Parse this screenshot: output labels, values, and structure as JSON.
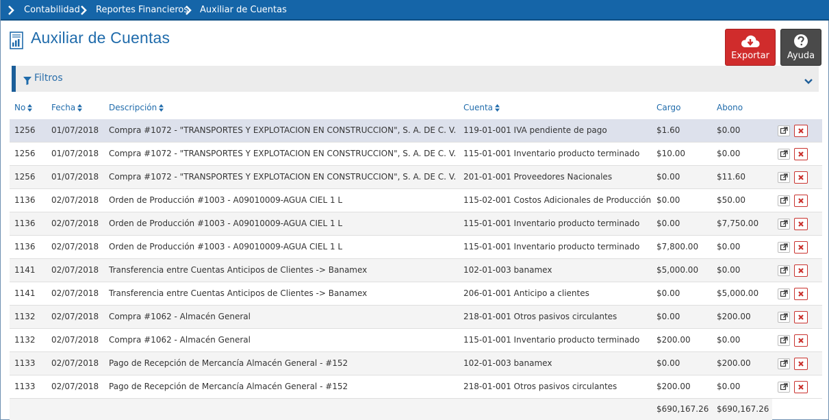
{
  "breadcrumb": [
    "Contabilidad",
    "Reportes Financieros",
    "Auxiliar de Cuentas"
  ],
  "page": {
    "title": "Auxiliar de Cuentas"
  },
  "toolbar": {
    "export_label": "Exportar",
    "help_label": "Ayuda"
  },
  "filters": {
    "label": "Filtros"
  },
  "colors": {
    "topbar": "#1565a8",
    "accent": "#1f6bab",
    "export": "#d02c2c",
    "help": "#4a4a4a",
    "selected_row": "#dde1ec"
  },
  "icons": {
    "title": "report-icon",
    "export": "cloud-download-icon",
    "help": "question-circle-icon",
    "filter": "filter-icon",
    "edit": "external-link-icon",
    "delete": "close-icon"
  },
  "table": {
    "columns": {
      "no": "No",
      "fecha": "Fecha",
      "descripcion": "Descripción",
      "cuenta": "Cuenta",
      "cargo": "Cargo",
      "abono": "Abono"
    },
    "rows": [
      {
        "no": "1256",
        "fecha": "01/07/2018",
        "descripcion": "Compra #1072 - \"TRANSPORTES Y EXPLOTACION EN CONSTRUCCION\", S. A. DE C. V.",
        "cuenta": "119-01-001 IVA pendiente de pago",
        "cargo": "$1.60",
        "abono": "$0.00",
        "selected": true
      },
      {
        "no": "1256",
        "fecha": "01/07/2018",
        "descripcion": "Compra #1072 - \"TRANSPORTES Y EXPLOTACION EN CONSTRUCCION\", S. A. DE C. V.",
        "cuenta": "115-01-001 Inventario producto terminado",
        "cargo": "$10.00",
        "abono": "$0.00"
      },
      {
        "no": "1256",
        "fecha": "01/07/2018",
        "descripcion": "Compra #1072 - \"TRANSPORTES Y EXPLOTACION EN CONSTRUCCION\", S. A. DE C. V.",
        "cuenta": "201-01-001 Proveedores Nacionales",
        "cargo": "$0.00",
        "abono": "$11.60"
      },
      {
        "no": "1136",
        "fecha": "02/07/2018",
        "descripcion": "Orden de Producción #1003 - A09010009-AGUA CIEL 1 L",
        "cuenta": "115-02-001 Costos Adicionales de Producción",
        "cargo": "$0.00",
        "abono": "$50.00"
      },
      {
        "no": "1136",
        "fecha": "02/07/2018",
        "descripcion": "Orden de Producción #1003 - A09010009-AGUA CIEL 1 L",
        "cuenta": "115-01-001 Inventario producto terminado",
        "cargo": "$0.00",
        "abono": "$7,750.00"
      },
      {
        "no": "1136",
        "fecha": "02/07/2018",
        "descripcion": "Orden de Producción #1003 - A09010009-AGUA CIEL 1 L",
        "cuenta": "115-01-001 Inventario producto terminado",
        "cargo": "$7,800.00",
        "abono": "$0.00"
      },
      {
        "no": "1141",
        "fecha": "02/07/2018",
        "descripcion": "Transferencia entre Cuentas Anticipos de Clientes -> Banamex",
        "cuenta": "102-01-003 banamex",
        "cargo": "$5,000.00",
        "abono": "$0.00"
      },
      {
        "no": "1141",
        "fecha": "02/07/2018",
        "descripcion": "Transferencia entre Cuentas Anticipos de Clientes -> Banamex",
        "cuenta": "206-01-001 Anticipo a clientes",
        "cargo": "$0.00",
        "abono": "$5,000.00"
      },
      {
        "no": "1132",
        "fecha": "02/07/2018",
        "descripcion": "Compra #1062 - Almacén General",
        "cuenta": "218-01-001 Otros pasivos circulantes",
        "cargo": "$0.00",
        "abono": "$200.00"
      },
      {
        "no": "1132",
        "fecha": "02/07/2018",
        "descripcion": "Compra #1062 - Almacén General",
        "cuenta": "115-01-001 Inventario producto terminado",
        "cargo": "$200.00",
        "abono": "$0.00"
      },
      {
        "no": "1133",
        "fecha": "02/07/2018",
        "descripcion": "Pago de Recepción de Mercancía Almacén General - #152",
        "cuenta": "102-01-003 banamex",
        "cargo": "$0.00",
        "abono": "$200.00"
      },
      {
        "no": "1133",
        "fecha": "02/07/2018",
        "descripcion": "Pago de Recepción de Mercancía Almacén General - #152",
        "cuenta": "218-01-001 Otros pasivos circulantes",
        "cargo": "$200.00",
        "abono": "$0.00"
      }
    ],
    "totals": {
      "cargo": "$690,167.26",
      "abono": "$690,167.26"
    }
  }
}
